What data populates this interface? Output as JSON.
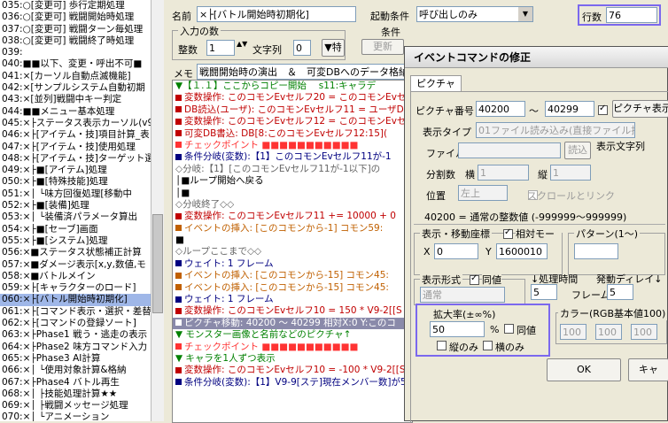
{
  "left_list": {
    "rows": [
      "035:○[変更可] 歩行定期処理",
      "036:○[変更可] 戦闘開始時処理",
      "037:○[変更可] 戦闘ターン毎処理",
      "038:○[変更可] 戦闘終了時処理",
      "039:",
      "040:■■以下、変更・呼出不可■",
      "041:×[カーソル自動点滅機能]",
      "042:×[サンプルシステム自動初期",
      "043:×[並列]戦闘中キー判定",
      "044:■■メニュー基本処理",
      "045:×├ステータス表示カーソル(v9",
      "046:×├[アイテム・技]項目計算_表",
      "047:×├[アイテム・技]使用処理",
      "048:×├[アイテム・技]ターゲット選択",
      "049:×├■[アイテム]処理",
      "050:×├■[特殊技能]処理",
      "051:×│ └味方回復処理[移動中",
      "052:×├■[装備]処理",
      "053:×│ └装備済パラメータ算出",
      "054:×├■[セーブ]画面",
      "055:×├■[システム]処理",
      "056:×■ステータス状態補正計算",
      "057:×■ダメージ表示[x,y,数値,モ",
      "058:×■バトルメイン",
      "059:×├[キャラクターのロード]",
      "060:×├[バトル開始時初期化]",
      "061:×├[コマンド表示・選択・差替",
      "062:×├[コマンドの登録ソート]",
      "063:×├Phase1 戦う・逃走の表示",
      "064:×├Phase2 味方コマンド入力",
      "065:×├Phase3 AI計算",
      "066:×│ └使用対象計算&格納",
      "067:×├Phase4 バトル再生",
      "068:×│ ├技能処理計算★★",
      "069:×│ ├戦闘メッセージ処理",
      "070:×│ └アニメーション"
    ],
    "selected_index": 25
  },
  "header": {
    "name_label": "名前",
    "name_value": "×├[バトル開始時初期化]",
    "trigger_label": "起動条件",
    "trigger_value": "呼び出しのみ",
    "lines_label": "行数",
    "lines_value": "76",
    "input_group_label": "入力の数",
    "int_label": "整数",
    "int_value": "1",
    "str_label": "文字列",
    "str_value": "0",
    "special_label": "▼特",
    "cond_label": "条件",
    "cond_btn": "更新",
    "memo_label": "メモ",
    "memo_value": "戦闘開始時の演出　＆　可変DBへのデータ格納"
  },
  "script_lines": [
    {
      "text": "▼【１.１】ここからコピー開始　 s11:キャラデ",
      "color": "#008000",
      "marker": ""
    },
    {
      "text": "変数操作: このコモンEvセルフ20 = このコモンEvセ",
      "color": "#c00000",
      "marker": "#c00000"
    },
    {
      "text": "DB読込(ユーザ): このコモンEvセルフ11 = ユーザDB",
      "color": "#c00000",
      "marker": "#c00000"
    },
    {
      "text": "変数操作: このコモンEvセルフ12 = このコモンEvセ",
      "color": "#c00000",
      "marker": "#c00000"
    },
    {
      "text": "可変DB書込: DB[8:このコモンEvセルフ12:15](",
      "color": "#c00000",
      "marker": "#c00000"
    },
    {
      "text": "チェックポイント ■■■■■■■■■■■",
      "color": "#ff3333",
      "marker": "#ff3333"
    },
    {
      "text": "条件分岐(変数):【1】このコモンEvセルフ11が-1",
      "color": "#000080",
      "marker": "#000080"
    },
    {
      "text": "◇分岐:【1】[このコモンEvセルフ11が-1以下]の",
      "color": "#666",
      "marker": ""
    },
    {
      "text": "│■ループ開始へ戻る",
      "color": "#000",
      "marker": ""
    },
    {
      "text": "│■",
      "color": "#000",
      "marker": ""
    },
    {
      "text": "◇分岐終了◇◇",
      "color": "#666",
      "marker": ""
    },
    {
      "text": "変数操作: このコモンEvセルフ11 += 10000 + 0",
      "color": "#c00000",
      "marker": "#c00000"
    },
    {
      "text": "イベントの挿入: [このコモンから-1] コモン59:",
      "color": "#c06000",
      "marker": "#c06000"
    },
    {
      "text": "■",
      "color": "#000",
      "marker": ""
    },
    {
      "text": "◇ループここまで◇◇",
      "color": "#666",
      "marker": ""
    },
    {
      "text": "ウェイト: 1 フレーム",
      "color": "#000080",
      "marker": "#000080"
    },
    {
      "text": "イベントの挿入: [このコモンから-15] コモン45:",
      "color": "#c06000",
      "marker": "#c06000"
    },
    {
      "text": "イベントの挿入: [このコモンから-15] コモン45:",
      "color": "#c06000",
      "marker": "#c06000"
    },
    {
      "text": "ウェイト: 1 フレーム",
      "color": "#000080",
      "marker": "#000080"
    },
    {
      "text": "変数操作: このコモンEvセルフ10 = 150 * V9-2[[S",
      "color": "#c00000",
      "marker": "#c00000"
    },
    {
      "text": "ピクチャ移動: 40200 〜 40299 相対X:0 Y:このコ",
      "color": "#ffffff",
      "marker": "#ffffff",
      "selected": true
    },
    {
      "text": "▼ モンスター画像と名前などのピクチャ↑",
      "color": "#008000",
      "marker": ""
    },
    {
      "text": "チェックポイント ■■■■■■■■■■■",
      "color": "#ff3333",
      "marker": "#ff3333"
    },
    {
      "text": "▼ キャラを1人ずつ表示",
      "color": "#008000",
      "marker": ""
    },
    {
      "text": "変数操作: このコモンEvセルフ10 = -100 * V9-2[[Ss]座標倍率]",
      "color": "#c00000",
      "marker": "#c00000"
    },
    {
      "text": "条件分岐(変数):【1】V9-9[ステ]現在メンバー数]が5以上",
      "color": "#000080",
      "marker": "#000080"
    }
  ],
  "dialog": {
    "title": "イベントコマンドの修正",
    "tab": "ピクチャ",
    "pic_no_label": "ピクチャ番号",
    "pic_from": "40200",
    "pic_tilde": "〜",
    "pic_to": "40299",
    "pic_display_btn": "ピクチャ表示",
    "display_type_label": "表示タイプ",
    "display_type_value": "01ファイル読み込み(直接ファイル指定)",
    "file_label": "ファイル",
    "read_btn": "読込",
    "display_text_label": "表示文字列",
    "split_label": "分割数",
    "split_w_label": "横",
    "split_w_value": "1",
    "split_h_label": "縦",
    "split_h_value": "1",
    "pos_label": "位置",
    "pos_value": "左上",
    "scroll_link_label": "スクロールとリンク",
    "info_line": "40200 = 通常の整数値 (-999999〜999999)",
    "coord_label": "表示・移動座標",
    "relative_label": "相対モード",
    "x_label": "X",
    "x_value": "0",
    "y_label": "Y",
    "y_value": "1600010",
    "pattern_label": "パターン(1〜)",
    "form_label": "表示形式",
    "same_label": "同値",
    "form_value": "通常",
    "proc_time_label": "↓処理時間",
    "proc_time_value": "5",
    "frame_label": "フレーム",
    "delay_label": "発動ディレイ↓",
    "delay_value": "5",
    "scale_label": "拡大率(±∞%)",
    "scale_value": "50",
    "percent": "%",
    "scale_same": "同値",
    "vert_only": "縦のみ",
    "horz_only": "横のみ",
    "color_label": "カラー(RGB基本値100)",
    "color_r": "100",
    "color_g": "100",
    "color_b": "100",
    "ok_btn": "OK",
    "cancel_btn": "キャ"
  },
  "colors": {
    "highlight": "#7b68ee",
    "selection": "#9fb7e8",
    "script_select": "#8a8aaa"
  }
}
